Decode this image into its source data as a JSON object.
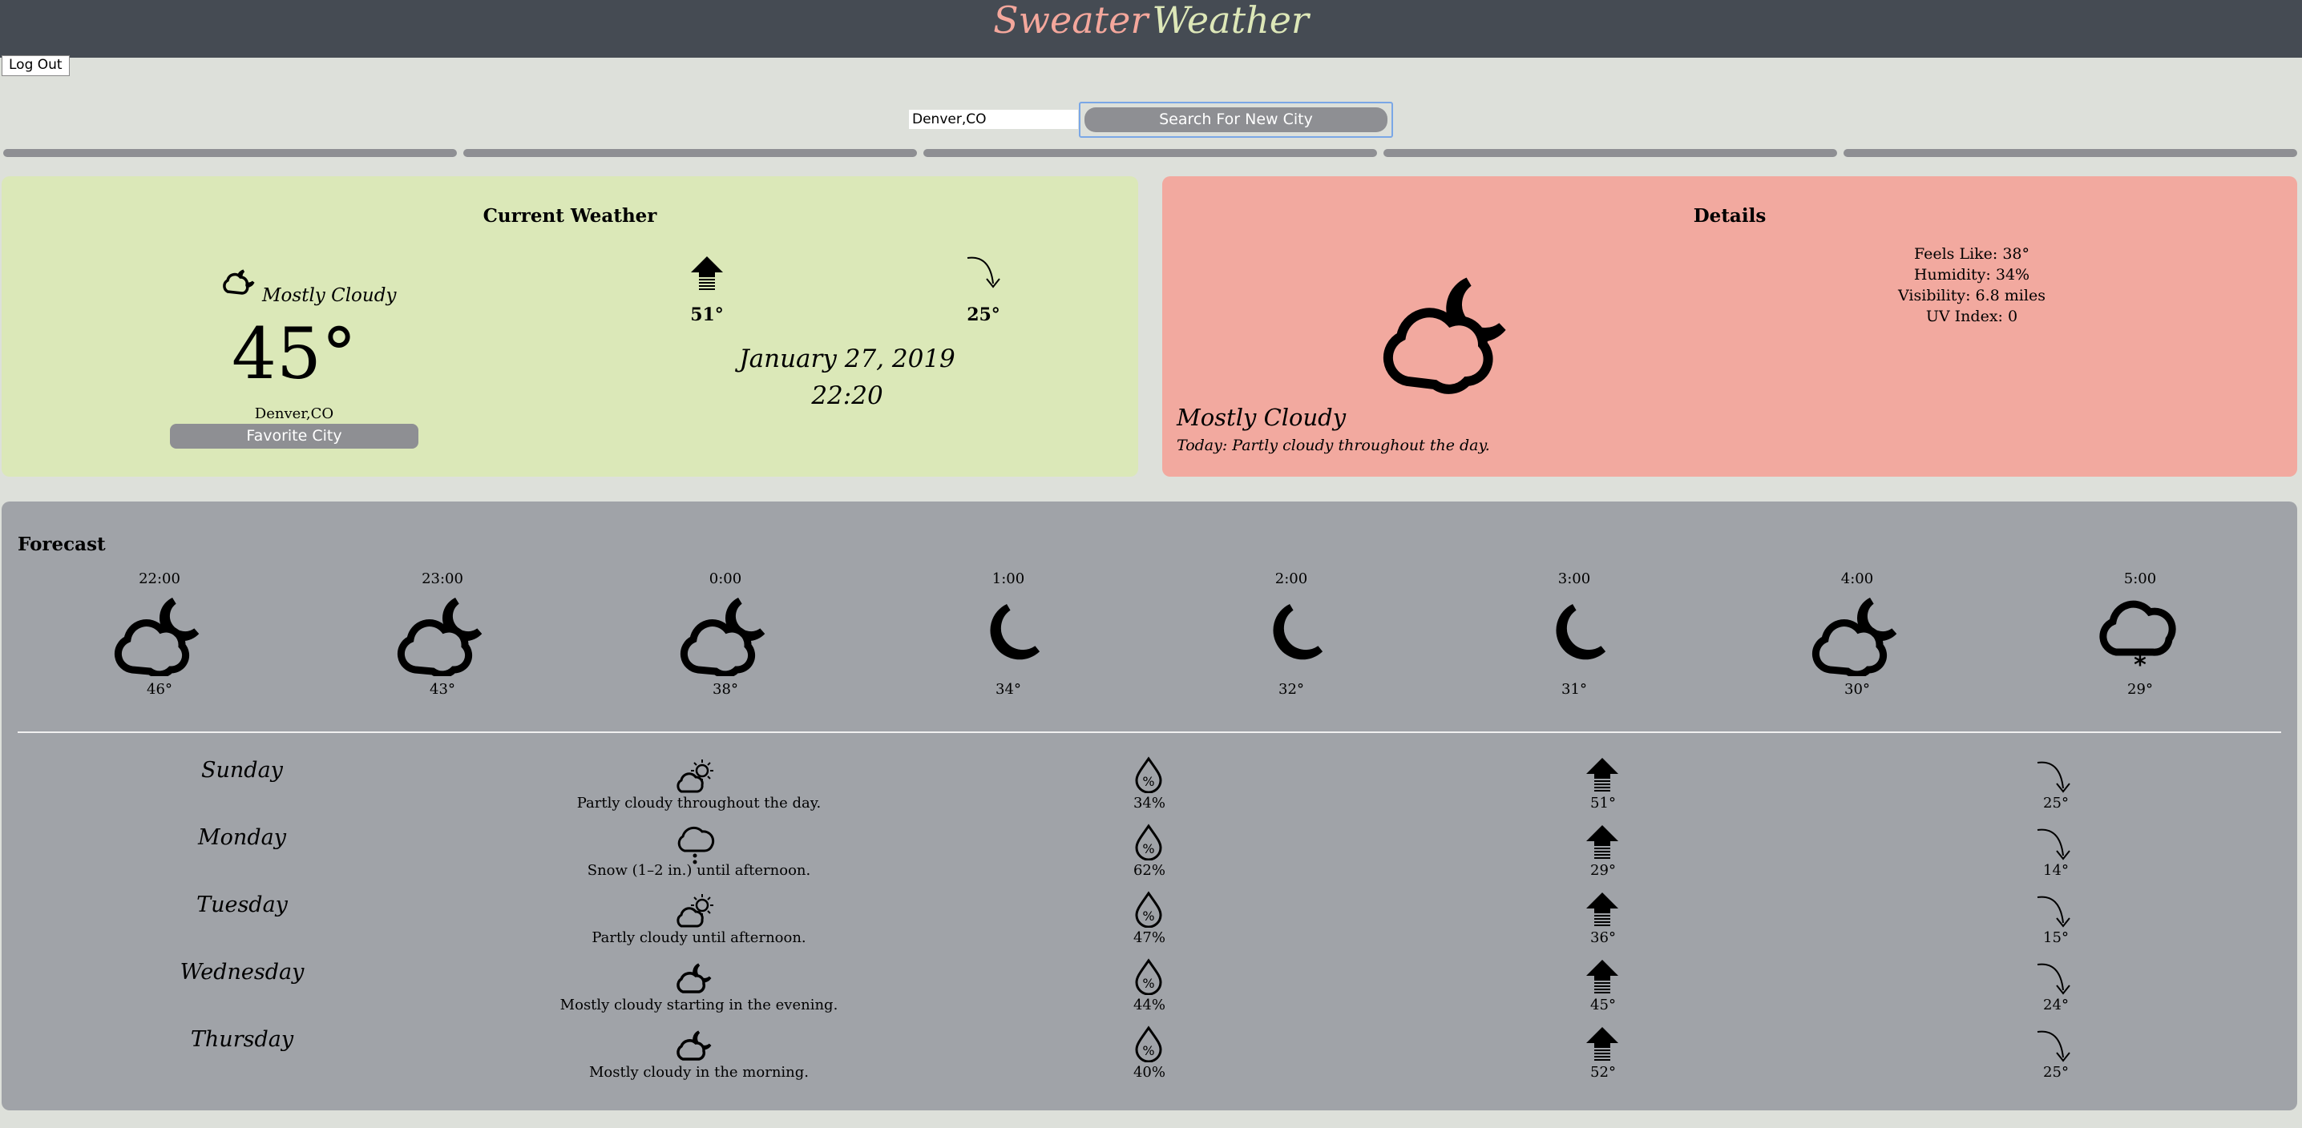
{
  "app": {
    "title_part1": "Sweater",
    "title_part2": "Weather"
  },
  "header": {
    "logout_label": "Log Out"
  },
  "search": {
    "value": "Denver,CO",
    "button_label": "Search For New City"
  },
  "current": {
    "title": "Current Weather",
    "summary": "Mostly Cloudy",
    "temperature": "45°",
    "location": "Denver,CO",
    "favorite_label": "Favorite City",
    "high": "51°",
    "low": "25°",
    "date": "January 27, 2019",
    "time": "22:20"
  },
  "details": {
    "title": "Details",
    "feels_like": "Feels Like: 38°",
    "humidity": "Humidity: 34%",
    "visibility": "Visibility: 6.8 miles",
    "uv_index": "UV Index: 0",
    "summary": "Mostly Cloudy",
    "today": "Today: Partly cloudy throughout the day."
  },
  "forecast": {
    "title": "Forecast",
    "hourly": [
      {
        "time": "22:00",
        "icon": "partly-cloudy-night-icon",
        "temp": "46°"
      },
      {
        "time": "23:00",
        "icon": "partly-cloudy-night-icon",
        "temp": "43°"
      },
      {
        "time": "0:00",
        "icon": "partly-cloudy-night-icon",
        "temp": "38°"
      },
      {
        "time": "1:00",
        "icon": "clear-night-icon",
        "temp": "34°"
      },
      {
        "time": "2:00",
        "icon": "clear-night-icon",
        "temp": "32°"
      },
      {
        "time": "3:00",
        "icon": "clear-night-icon",
        "temp": "31°"
      },
      {
        "time": "4:00",
        "icon": "partly-cloudy-night-icon",
        "temp": "30°"
      },
      {
        "time": "5:00",
        "icon": "snow-icon",
        "temp": "29°"
      }
    ],
    "daily": [
      {
        "day": "Sunday",
        "icon": "partly-cloudy-day-icon",
        "summary": "Partly cloudy throughout the day.",
        "precip": "34%",
        "high": "51°",
        "low": "25°"
      },
      {
        "day": "Monday",
        "icon": "snow-icon",
        "summary": "Snow (1–2 in.) until afternoon.",
        "precip": "62%",
        "high": "29°",
        "low": "14°"
      },
      {
        "day": "Tuesday",
        "icon": "partly-cloudy-day-icon",
        "summary": "Partly cloudy until afternoon.",
        "precip": "47%",
        "high": "36°",
        "low": "15°"
      },
      {
        "day": "Wednesday",
        "icon": "partly-cloudy-night-icon",
        "summary": "Mostly cloudy starting in the evening.",
        "precip": "44%",
        "high": "45°",
        "low": "24°"
      },
      {
        "day": "Thursday",
        "icon": "partly-cloudy-night-icon",
        "summary": "Mostly cloudy in the morning.",
        "precip": "40%",
        "high": "52°",
        "low": "25°"
      }
    ]
  },
  "colors": {
    "banner": "#454b53",
    "title_accent_1": "#f4a79c",
    "title_accent_2": "#dde7b8",
    "current_panel": "#dbe8b8",
    "details_panel": "#f2a99f",
    "forecast_panel": "#a0a3a8",
    "button_gray": "#8e8f93"
  }
}
